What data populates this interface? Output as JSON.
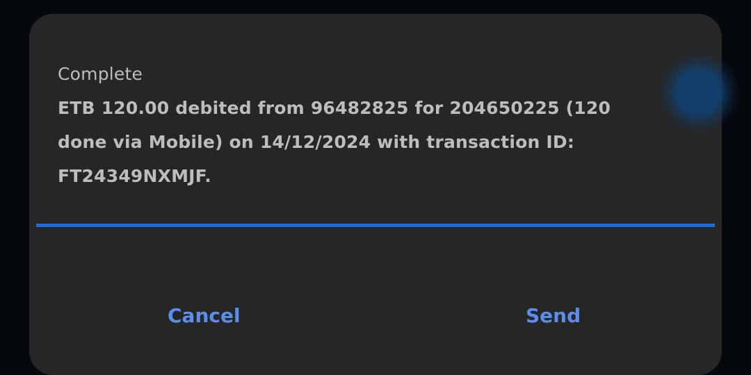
{
  "dialog": {
    "title": "Complete",
    "message": "ETB 120.00 debited from 96482825 for 204650225 (120 done via Mobile) on 14/12/2024 with transaction ID: FT24349NXMJF.",
    "cancel_label": "Cancel",
    "send_label": "Send"
  },
  "colors": {
    "dialog_background": "#262626",
    "accent": "#1a6be0",
    "button_text": "#5b8def",
    "text": "#bdbdbd"
  }
}
